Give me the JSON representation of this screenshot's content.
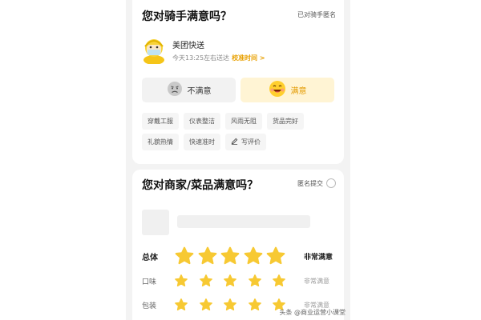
{
  "rider_section": {
    "title": "您对骑手满意吗？",
    "anonymous": "已对骑手匿名",
    "rider_name": "美团快送",
    "delivery_time": "今天13:25左右送达",
    "accuracy_link": "校准时间 >",
    "unsatisfied_label": "不满意",
    "satisfied_label": "满意",
    "tags": [
      "穿戴工服",
      "仪表整洁",
      "风雨无阻",
      "货品完好",
      "礼貌热情",
      "快速准时"
    ],
    "write_review": "写评价"
  },
  "merchant_section": {
    "title": "您对商家/菜品满意吗？",
    "anonymous": "匿名提交",
    "ratings": [
      {
        "label": "总体",
        "stars": 5,
        "text": "非常满意"
      },
      {
        "label": "口味",
        "stars": 5,
        "text": "非常满意"
      },
      {
        "label": "包装",
        "stars": 5,
        "text": "非常满意"
      }
    ]
  },
  "watermark": "头条 @商业运营小课堂",
  "colors": {
    "accent": "#e8a000",
    "star": "#f7c933",
    "good_bg": "#fff4d4"
  }
}
